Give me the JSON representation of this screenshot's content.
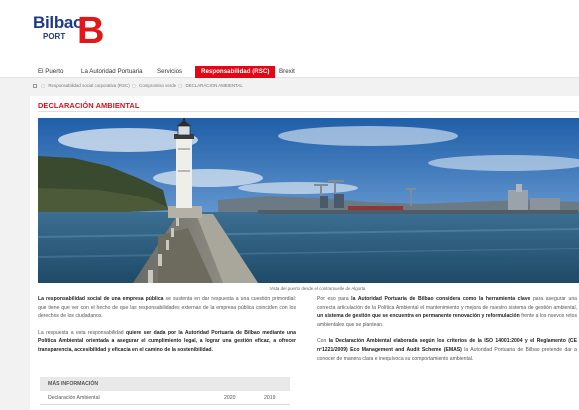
{
  "header": {
    "logo": {
      "bilbao": "Bilbao",
      "port": "PORT",
      "letter": "B"
    }
  },
  "nav": {
    "items": [
      {
        "label": "El Puerto"
      },
      {
        "label": "La Autoridad Portuaria"
      },
      {
        "label": "Servicios"
      },
      {
        "label": "Responsabilidad (RSC)",
        "active": true
      },
      {
        "label": "Brexit"
      }
    ]
  },
  "breadcrumb": {
    "items": [
      "Responsabilidad social corporativa (RSC)",
      "Compromiso verde",
      "DECLARACION AMBIENTAL"
    ]
  },
  "main": {
    "title": "DECLARACIÓN AMBIENTAL",
    "hero_caption": "Vista del puerto desde el contramuelle de Algorta",
    "left": {
      "p1": {
        "b1": "La responsabilidad social de una empresa pública",
        "t1": " se sustenta en dar respuesta a una cuestión primordial: que tiene que ver con el hecho de que las responsabilidades externas de la empresa pública coinciden con los derechos de los ciudadanos."
      },
      "p2": {
        "t1": "La respuesta a esta responsabilidad ",
        "b1": "quiere ser dada por la Autoridad Portuaria de Bilbao mediante una Política Ambiental orientada a asegurar el cumplimiento legal, a lograr una gestión eficaz, a ofrecer transparencia, accesibilidad y eficacia en el camino de la sostenibilidad."
      }
    },
    "right": {
      "p1": {
        "t1": "Por eso para ",
        "b1": "la Autoridad Portuaria de Bilbao considera como la herramienta clave",
        "t2": " para asegurar una correcta articulación de la Política Ambiental el mantenimiento y mejora de nuestro sistema de gestión ambiental, ",
        "b2": "un sistema de gestión que se encuentra en permanente renovación y reformulación",
        "t3": " frente a los nuevos retos ambientales que se plantean."
      },
      "p2": {
        "t1": "Con ",
        "b1": "la Declaración Ambiental elaborada según los criterios de la ISO 14001:2004 y el Reglamento (CE nº1221/2009) Eco Management and Audit Scheme (EMAS)",
        "t2": " la Autoridad Portuaria de Bilbao pretende dar a conocer de manera clara e inequívoca su comportamiento ambiental."
      }
    },
    "info": {
      "title": "MÁS INFORMACIÓN",
      "rows": [
        {
          "label": "Declaración Ambiental",
          "years": [
            "2020",
            "2019"
          ]
        }
      ]
    }
  },
  "colors": {
    "accent_red": "#e30613",
    "title_red": "#d4121e",
    "brand_blue": "#1f3a8a"
  }
}
